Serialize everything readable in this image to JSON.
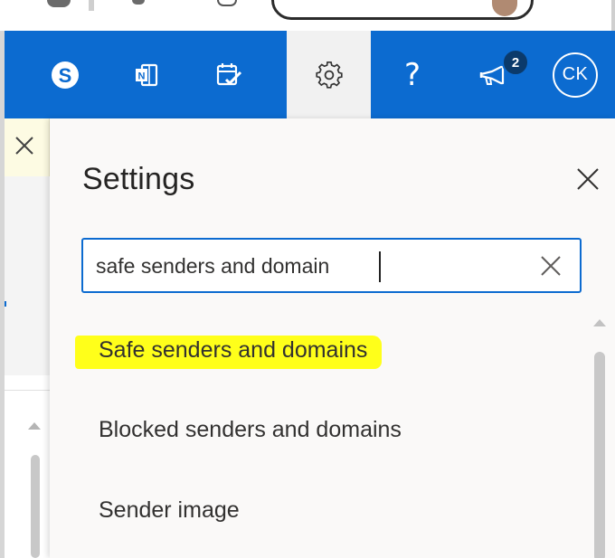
{
  "header": {
    "buttons": [
      {
        "name": "skype-icon"
      },
      {
        "name": "onenote-feed-icon"
      },
      {
        "name": "my-day-icon"
      },
      {
        "name": "gear-icon"
      },
      {
        "name": "help-icon",
        "glyph": "?"
      },
      {
        "name": "whats-new-icon",
        "badge": "2"
      },
      {
        "name": "account-avatar",
        "initials": "CK"
      }
    ],
    "accent_color": "#0c6bd0"
  },
  "settings": {
    "title": "Settings",
    "search": {
      "value": "safe senders and domain",
      "placeholder": ""
    },
    "results": [
      {
        "label": "Safe senders and domains",
        "highlighted": true
      },
      {
        "label": "Blocked senders and domains",
        "highlighted": false
      },
      {
        "label": "Sender image",
        "highlighted": false
      }
    ],
    "highlight_color": "#ffff1a"
  }
}
